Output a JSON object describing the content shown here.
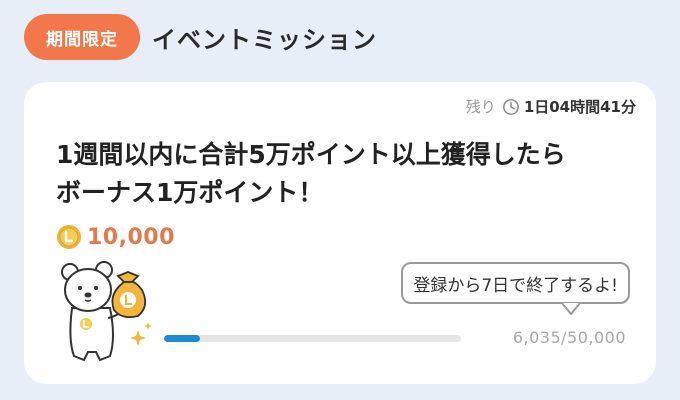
{
  "header": {
    "badge": "期間限定",
    "title": "イベントミッション"
  },
  "card": {
    "remaining_label": "残り",
    "remaining_time": "1日04時間41分",
    "title_line1": "1週間以内に合計5万ポイント以上獲得したら",
    "title_line2": "ボーナス1万ポイント！",
    "reward_amount": "10,000",
    "bubble_text": "登録から7日で終了するよ!",
    "progress": {
      "current": 6035,
      "goal": 50000,
      "text": "6,035/50,000"
    }
  },
  "colors": {
    "badge": "#F2774A",
    "reward": "#E6784E",
    "progress_fill": "#1E8CD0",
    "background": "#E8EEF7"
  },
  "icons": [
    "clock-icon",
    "coin-icon",
    "bear-mascot",
    "money-bag-icon",
    "sparkle-icon"
  ]
}
